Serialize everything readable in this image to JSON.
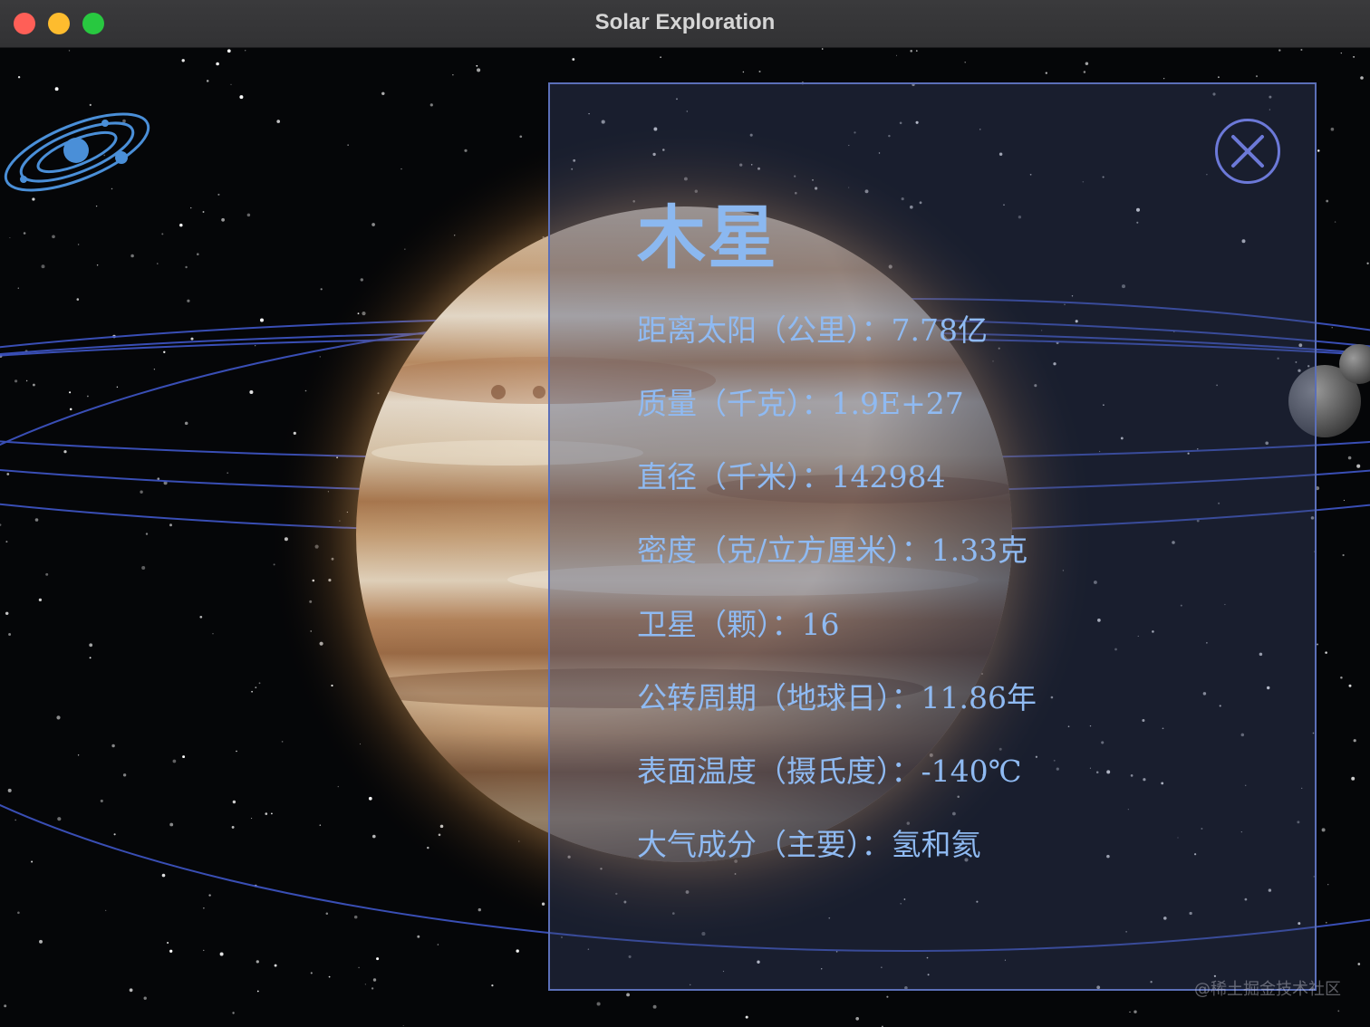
{
  "window": {
    "title": "Solar Exploration"
  },
  "panel": {
    "planet_name": "木星",
    "rows": [
      "距离太阳（公里）：7.78亿",
      "质量（千克）：1.9E+27",
      "直径（千米）：142984",
      "密度（克/立方厘米）：1.33克",
      "卫星（颗）：16",
      "公转周期（地球日）：11.86年",
      "表面温度（摄氏度）：-140℃",
      "大气成分（主要）：氢和氦"
    ]
  },
  "watermark": "@稀土掘金技术社区",
  "colors": {
    "accent": "#8fbaf2",
    "panel_border": "#5b6fb8",
    "close_button": "#6c79d8",
    "orbit": "#3f56c8"
  },
  "icons": {
    "logo": "solar-system-logo-icon",
    "close": "close-icon"
  }
}
